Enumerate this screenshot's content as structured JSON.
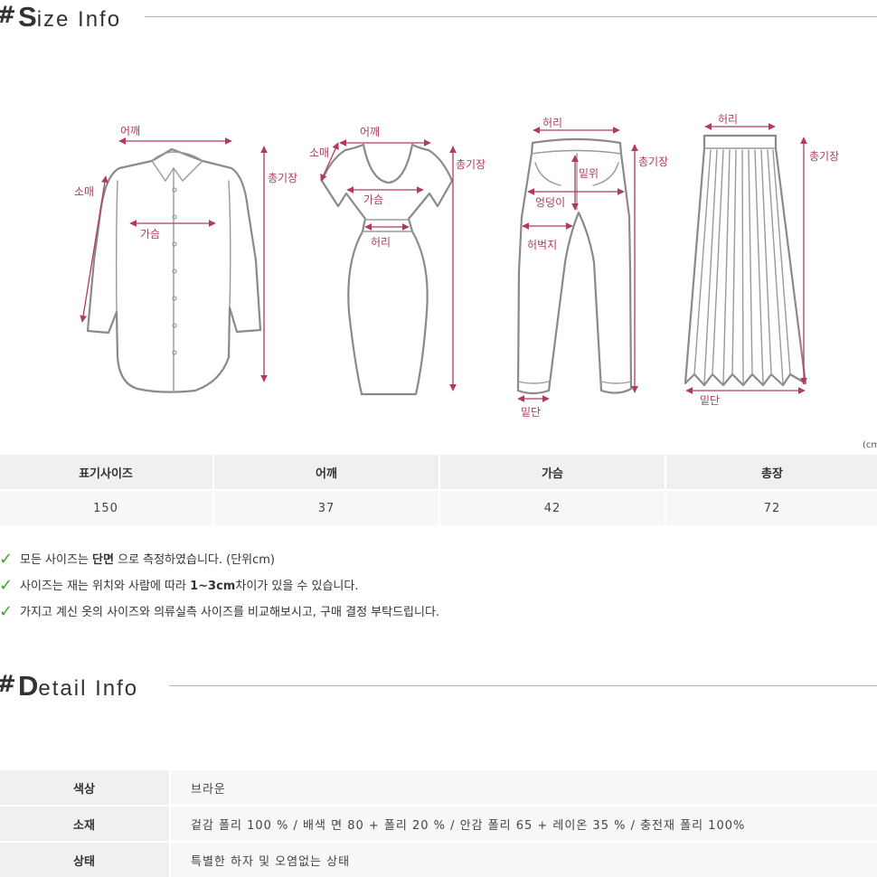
{
  "size_section": {
    "hash": "#",
    "initial": "S",
    "rest": "ize Info"
  },
  "diagram_labels": {
    "shirt": {
      "shoulder": "어깨",
      "sleeve": "소매",
      "chest": "가슴",
      "total_length": "총기장"
    },
    "dress": {
      "shoulder": "어깨",
      "sleeve": "소매",
      "chest": "가슴",
      "waist": "허리",
      "total_length": "총기장"
    },
    "pants": {
      "waist": "허리",
      "rise": "밑위",
      "hip": "엉덩이",
      "thigh": "허벅지",
      "hem": "밑단",
      "total_length": "총기장"
    },
    "skirt": {
      "waist": "허리",
      "hem": "밑단",
      "total_length": "총기장"
    }
  },
  "unit_note": "(cm",
  "size_table": {
    "headers": [
      "표기사이즈",
      "어깨",
      "가슴",
      "총장"
    ],
    "rows": [
      [
        "150",
        "37",
        "42",
        "72"
      ]
    ]
  },
  "notes": [
    {
      "pre": "모든 사이즈는 ",
      "bold": "단면",
      "post": " 으로 측정하였습니다. (단위cm)"
    },
    {
      "pre": "사이즈는 재는 위치와 사람에 따라 ",
      "bold": "1~3cm",
      "post": "차이가 있을 수 있습니다."
    },
    {
      "pre": "가지고 계신 옷의 사이즈와 의류실측 사이즈를 비교해보시고, 구매 결정 부탁드립니다.",
      "bold": "",
      "post": ""
    }
  ],
  "detail_section": {
    "hash": "#",
    "initial": "D",
    "rest": "etail Info"
  },
  "detail_table": [
    {
      "label": "색상",
      "value": "브라운"
    },
    {
      "label": "소재",
      "value": "겉감 폴리 100 % / 배색 면 80 + 폴리 20 % / 안감 폴리 65 + 레이온 35 % / 충전재 폴리 100%"
    },
    {
      "label": "상태",
      "value": "특별한 하자 및 오염없는 상태"
    }
  ],
  "colors": {
    "accent": "#b03a63",
    "check": "#3fa22e",
    "header_bg": "#f0f0f0",
    "cell_bg": "#f7f7f7"
  }
}
